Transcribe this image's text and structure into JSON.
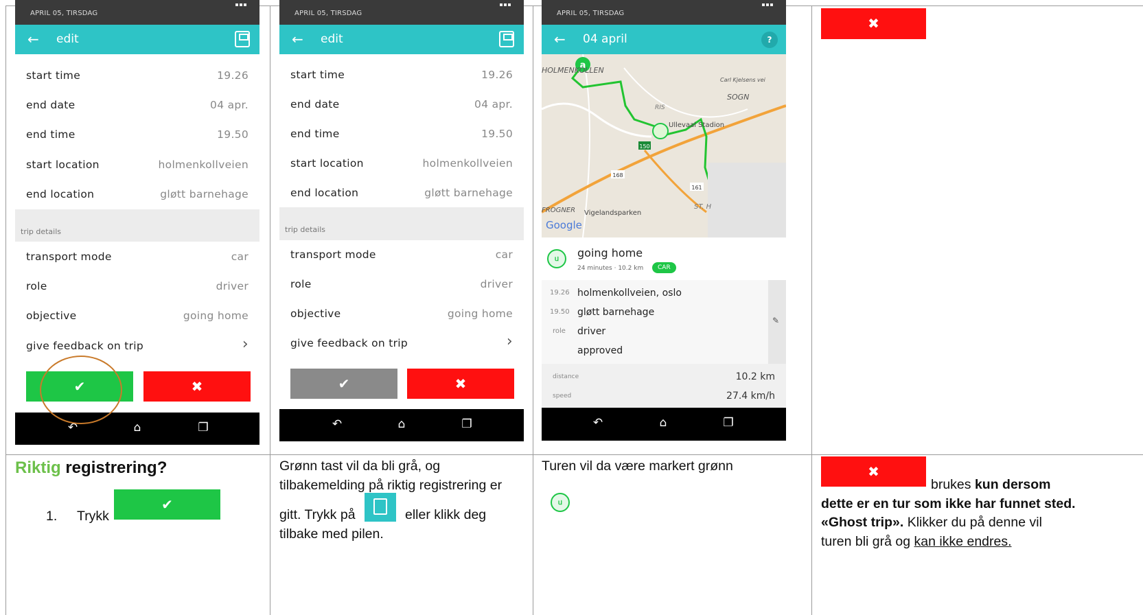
{
  "status": {
    "date": "APRIL 05, TIRSDAG"
  },
  "panel1": {
    "title": "edit",
    "rows": [
      {
        "key": "start time",
        "value": "19.26"
      },
      {
        "key": "end date",
        "value": "04 apr."
      },
      {
        "key": "end time",
        "value": "19.50"
      },
      {
        "key": "start location",
        "value": "holmenkollveien"
      },
      {
        "key": "end location",
        "value": "gløtt barnehage"
      }
    ],
    "section": "trip details",
    "rows2": [
      {
        "key": "transport mode",
        "value": "car"
      },
      {
        "key": "role",
        "value": "driver"
      },
      {
        "key": "objective",
        "value": "going home"
      },
      {
        "key": "give feedback on trip",
        "value": "›"
      }
    ],
    "confirm_icon": "✔",
    "reject_icon": "✖"
  },
  "panel3": {
    "title": "04 april",
    "help": "?",
    "map_labels": {
      "holmen": "HOLMENKOLLEN",
      "sogn": "SOGN",
      "stadion": "Ullevaal Stadion",
      "vigeland": "Vigelandsparken",
      "google": "Google",
      "road150": "150",
      "road168": "168",
      "road161": "161",
      "ris": "RIS",
      "vei": "Carl Kjelsens vei",
      "st": "ST. H",
      "frogner": "FROGNER",
      "a": "a"
    },
    "trip_name": "going home",
    "trip_meta": "24 minutes · 10.2 km",
    "trip_badge": "CAR",
    "stops": [
      {
        "time": "19.26",
        "text": "holmenkollveien, oslo"
      },
      {
        "time": "19.50",
        "text": "gløtt barnehage"
      },
      {
        "time": "role",
        "text": "driver"
      },
      {
        "time": "",
        "text": "approved"
      }
    ],
    "stats": [
      {
        "label": "distance",
        "value": "10.2 km"
      },
      {
        "label": "speed",
        "value": "27.4 km/h"
      }
    ]
  },
  "captions": {
    "c1_title_green": "Riktig",
    "c1_title_rest": " registrering?",
    "c1_num": "1.",
    "c1_text": "Trykk",
    "c2_l1": "Grønn tast vil da bli grå, og",
    "c2_l2": "tilbakemelding på riktig registrering er",
    "c2_l3a": "gitt. Trykk på",
    "c2_l3b": "eller klikk deg",
    "c2_l4": "tilbake med pilen.",
    "c3": "Turen vil da være markert grønn",
    "c4_a": "brukes ",
    "c4_b": "kun dersom",
    "c4_l2": "dette er en tur som ikke har funnet sted.",
    "c4_l3a": "«Ghost trip».",
    "c4_l3b": " Klikker du på denne vil",
    "c4_l4a": "turen bli grå og ",
    "c4_l4b": "kan ikke endres."
  },
  "colors": {
    "teal": "#2ec4c6",
    "green": "#1ec646",
    "red": "#ff1010",
    "gray": "#8a8a8a",
    "title_green": "#6cc04a"
  }
}
